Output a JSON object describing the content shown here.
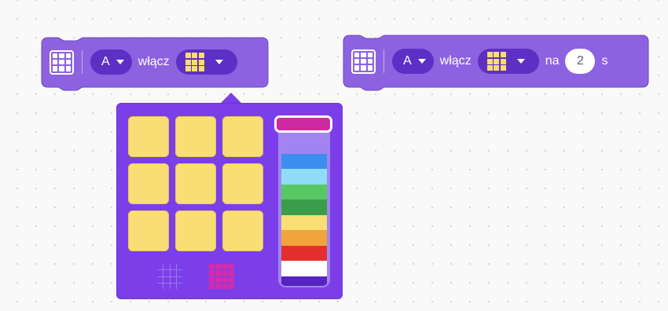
{
  "block1": {
    "port": "A",
    "verb": "włącz"
  },
  "block2": {
    "port": "A",
    "verb": "włącz",
    "na_label": "na",
    "duration": "2",
    "unit": "s"
  },
  "colors": {
    "block": "#8d62e0",
    "dropdown": "#7b3ee9",
    "pixel_on": "#f8de74"
  },
  "palette": {
    "selected": "#cd2aa2",
    "swatches": [
      "#cd2aa2",
      "#a184f2",
      "#3b8ef0",
      "#8fdcf6",
      "#57c763",
      "#3b9d4a",
      "#f8de74",
      "#f0a43b",
      "#e42f2f",
      "#ffffff",
      "#5523c1"
    ]
  },
  "icons": [
    "hub-matrix-icon",
    "chevron-down-icon",
    "grid-off-icon",
    "grid-on-icon"
  ]
}
